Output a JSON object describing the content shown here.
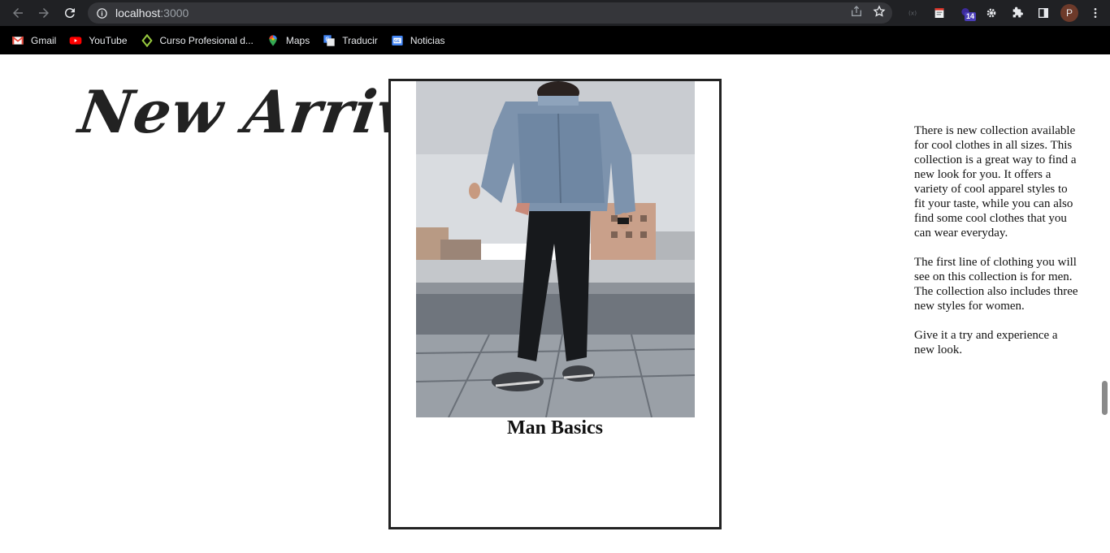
{
  "browser": {
    "url_host": "localhost",
    "url_port": ":3000",
    "extension_badge": "14",
    "profile_initial": "P",
    "bookmarks": [
      {
        "label": "Gmail",
        "icon": "gmail-icon"
      },
      {
        "label": "YouTube",
        "icon": "youtube-icon"
      },
      {
        "label": "Curso Profesional d...",
        "icon": "course-icon"
      },
      {
        "label": "Maps",
        "icon": "maps-icon"
      },
      {
        "label": "Traducir",
        "icon": "translate-icon"
      },
      {
        "label": "Noticias",
        "icon": "news-icon"
      }
    ]
  },
  "page": {
    "title": "New Arrival",
    "card": {
      "image_alt": "man-in-denim-jacket-photo",
      "caption": "Man Basics"
    },
    "description": [
      "There is new collection available for cool clothes in all sizes. This collection is a great way to find a new look for you. It offers a variety of cool apparel styles to fit your taste, while you can also find some cool clothes that you can wear everyday.",
      "The first line of clothing you will see on this collection is for men. The collection also includes three new styles for women.",
      "Give it a try and experience a new look."
    ]
  },
  "colors": {
    "chrome_bg": "#202124",
    "bookmarks_bg": "#000000",
    "text_dark": "#222222",
    "card_border": "#222222"
  }
}
